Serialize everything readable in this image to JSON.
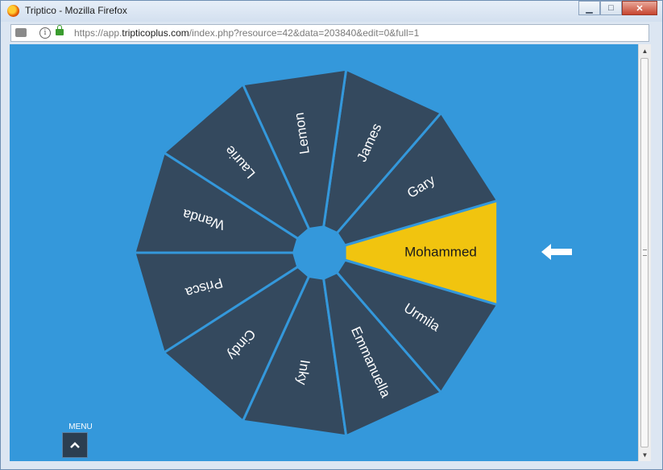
{
  "window": {
    "title": "Triptico - Mozilla Firefox",
    "minimize_glyph": "▁",
    "maximize_glyph": "□",
    "close_glyph": "✕"
  },
  "urlbar": {
    "prefix": "https://app.",
    "host": "tripticoplus.com",
    "path": "/index.php?resource=42&data=203840&edit=0&full=1",
    "info_glyph": "i"
  },
  "wheel": {
    "colors": {
      "slice": "#34495e",
      "selected": "#f1c40f",
      "background": "#3498db",
      "divider": "#3498db"
    },
    "selected_index": 0,
    "names": [
      "Mohammed",
      "Gary",
      "James",
      "Lemon",
      "Laurie",
      "Wanda",
      "Prisca",
      "Cindy",
      "Inky",
      "Emmanuella",
      "Urmila"
    ],
    "pointer_icon": "left-arrow-icon"
  },
  "menu": {
    "label": "MENU",
    "icon": "chevron-up-icon"
  }
}
